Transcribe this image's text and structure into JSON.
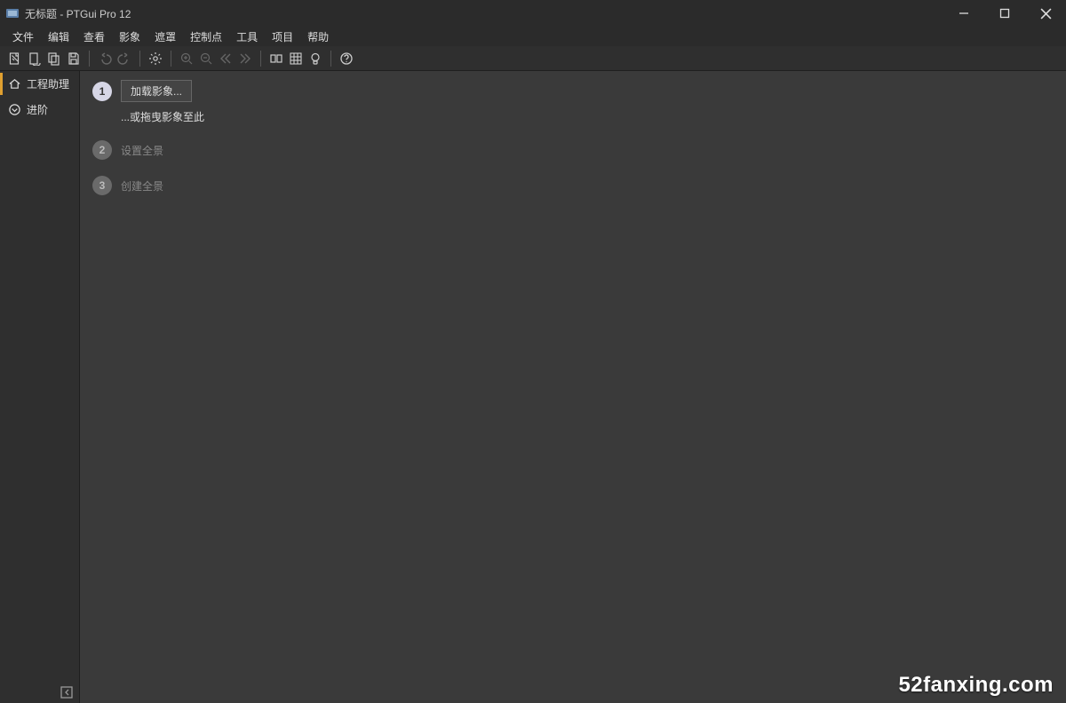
{
  "window": {
    "title": "无标题 - PTGui Pro 12"
  },
  "menu": [
    "文件",
    "编辑",
    "查看",
    "影象",
    "遮罩",
    "控制点",
    "工具",
    "项目",
    "帮助"
  ],
  "sidebar": {
    "items": [
      {
        "label": "工程助理"
      },
      {
        "label": "进阶"
      }
    ]
  },
  "steps": {
    "s1": {
      "num": "1",
      "button": "加载影象...",
      "hint": "...或拖曳影象至此"
    },
    "s2": {
      "num": "2",
      "label": "设置全景"
    },
    "s3": {
      "num": "3",
      "label": "创建全景"
    }
  },
  "watermark": "52fanxing.com"
}
